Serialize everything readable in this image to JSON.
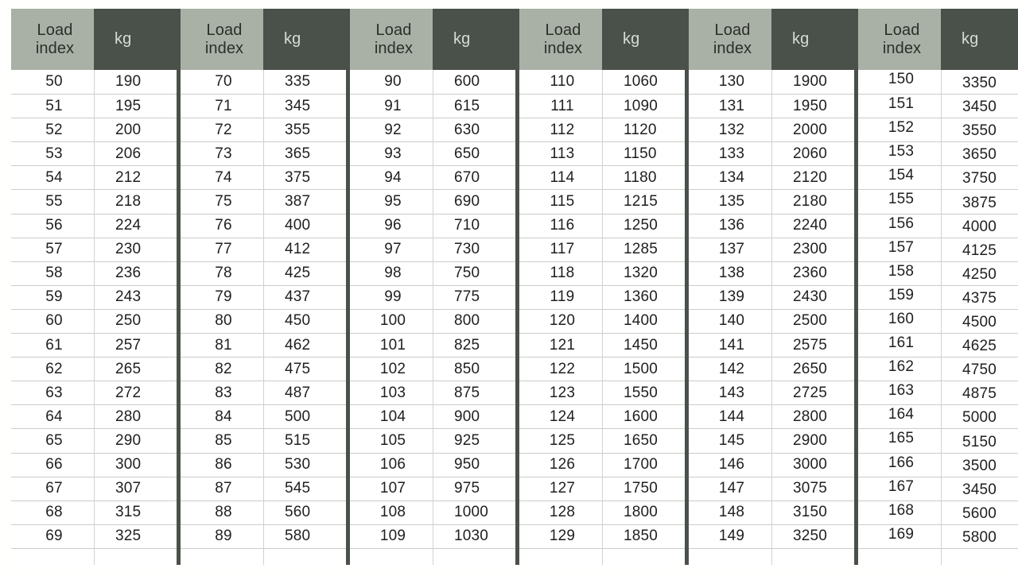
{
  "table": {
    "header": {
      "index_label": "Load\nindex",
      "kg_label": "kg"
    },
    "colors": {
      "header_index_bg": "#a9b0a6",
      "header_kg_bg": "#4a514a",
      "header_kg_text": "#d8dcd6",
      "group_separator": "#4a514a",
      "row_divider": "#c9cdc7",
      "body_bg": "#ffffff",
      "page_bg": "#fffffd",
      "body_text": "#1d201d"
    },
    "groups": [
      {
        "name": "group-50-69",
        "rows": [
          {
            "index": "50",
            "kg": "190"
          },
          {
            "index": "51",
            "kg": "195"
          },
          {
            "index": "52",
            "kg": "200"
          },
          {
            "index": "53",
            "kg": "206"
          },
          {
            "index": "54",
            "kg": "212"
          },
          {
            "index": "55",
            "kg": "218"
          },
          {
            "index": "56",
            "kg": "224"
          },
          {
            "index": "57",
            "kg": "230"
          },
          {
            "index": "58",
            "kg": "236"
          },
          {
            "index": "59",
            "kg": "243"
          },
          {
            "index": "60",
            "kg": "250"
          },
          {
            "index": "61",
            "kg": "257"
          },
          {
            "index": "62",
            "kg": "265"
          },
          {
            "index": "63",
            "kg": "272"
          },
          {
            "index": "64",
            "kg": "280"
          },
          {
            "index": "65",
            "kg": "290"
          },
          {
            "index": "66",
            "kg": "300"
          },
          {
            "index": "67",
            "kg": "307"
          },
          {
            "index": "68",
            "kg": "315"
          },
          {
            "index": "69",
            "kg": "325"
          }
        ]
      },
      {
        "name": "group-70-89",
        "rows": [
          {
            "index": "70",
            "kg": "335"
          },
          {
            "index": "71",
            "kg": "345"
          },
          {
            "index": "72",
            "kg": "355"
          },
          {
            "index": "73",
            "kg": "365"
          },
          {
            "index": "74",
            "kg": "375"
          },
          {
            "index": "75",
            "kg": "387"
          },
          {
            "index": "76",
            "kg": "400"
          },
          {
            "index": "77",
            "kg": "412"
          },
          {
            "index": "78",
            "kg": "425"
          },
          {
            "index": "79",
            "kg": "437"
          },
          {
            "index": "80",
            "kg": "450"
          },
          {
            "index": "81",
            "kg": "462"
          },
          {
            "index": "82",
            "kg": "475"
          },
          {
            "index": "83",
            "kg": "487"
          },
          {
            "index": "84",
            "kg": "500"
          },
          {
            "index": "85",
            "kg": "515"
          },
          {
            "index": "86",
            "kg": "530"
          },
          {
            "index": "87",
            "kg": "545"
          },
          {
            "index": "88",
            "kg": "560"
          },
          {
            "index": "89",
            "kg": "580"
          }
        ]
      },
      {
        "name": "group-90-109",
        "rows": [
          {
            "index": "90",
            "kg": "600"
          },
          {
            "index": "91",
            "kg": "615"
          },
          {
            "index": "92",
            "kg": "630"
          },
          {
            "index": "93",
            "kg": "650"
          },
          {
            "index": "94",
            "kg": "670"
          },
          {
            "index": "95",
            "kg": "690"
          },
          {
            "index": "96",
            "kg": "710"
          },
          {
            "index": "97",
            "kg": "730"
          },
          {
            "index": "98",
            "kg": "750"
          },
          {
            "index": "99",
            "kg": "775"
          },
          {
            "index": "100",
            "kg": "800"
          },
          {
            "index": "101",
            "kg": "825"
          },
          {
            "index": "102",
            "kg": "850"
          },
          {
            "index": "103",
            "kg": "875"
          },
          {
            "index": "104",
            "kg": "900"
          },
          {
            "index": "105",
            "kg": "925"
          },
          {
            "index": "106",
            "kg": "950"
          },
          {
            "index": "107",
            "kg": "975"
          },
          {
            "index": "108",
            "kg": "1000"
          },
          {
            "index": "109",
            "kg": "1030"
          }
        ]
      },
      {
        "name": "group-110-129",
        "rows": [
          {
            "index": "110",
            "kg": "1060"
          },
          {
            "index": "111",
            "kg": "1090"
          },
          {
            "index": "112",
            "kg": "1120"
          },
          {
            "index": "113",
            "kg": "1150"
          },
          {
            "index": "114",
            "kg": "1180"
          },
          {
            "index": "115",
            "kg": "1215"
          },
          {
            "index": "116",
            "kg": "1250"
          },
          {
            "index": "117",
            "kg": "1285"
          },
          {
            "index": "118",
            "kg": "1320"
          },
          {
            "index": "119",
            "kg": "1360"
          },
          {
            "index": "120",
            "kg": "1400"
          },
          {
            "index": "121",
            "kg": "1450"
          },
          {
            "index": "122",
            "kg": "1500"
          },
          {
            "index": "123",
            "kg": "1550"
          },
          {
            "index": "124",
            "kg": "1600"
          },
          {
            "index": "125",
            "kg": "1650"
          },
          {
            "index": "126",
            "kg": "1700"
          },
          {
            "index": "127",
            "kg": "1750"
          },
          {
            "index": "128",
            "kg": "1800"
          },
          {
            "index": "129",
            "kg": "1850"
          }
        ]
      },
      {
        "name": "group-130-149",
        "rows": [
          {
            "index": "130",
            "kg": "1900"
          },
          {
            "index": "131",
            "kg": "1950"
          },
          {
            "index": "132",
            "kg": "2000"
          },
          {
            "index": "133",
            "kg": "2060"
          },
          {
            "index": "134",
            "kg": "2120"
          },
          {
            "index": "135",
            "kg": "2180"
          },
          {
            "index": "136",
            "kg": "2240"
          },
          {
            "index": "137",
            "kg": "2300"
          },
          {
            "index": "138",
            "kg": "2360"
          },
          {
            "index": "139",
            "kg": "2430"
          },
          {
            "index": "140",
            "kg": "2500"
          },
          {
            "index": "141",
            "kg": "2575"
          },
          {
            "index": "142",
            "kg": "2650"
          },
          {
            "index": "143",
            "kg": "2725"
          },
          {
            "index": "144",
            "kg": "2800"
          },
          {
            "index": "145",
            "kg": "2900"
          },
          {
            "index": "146",
            "kg": "3000"
          },
          {
            "index": "147",
            "kg": "3075"
          },
          {
            "index": "148",
            "kg": "3150"
          },
          {
            "index": "149",
            "kg": "3250"
          }
        ]
      },
      {
        "name": "group-150-169",
        "offset": true,
        "rows": [
          {
            "index": "150",
            "kg": "3350"
          },
          {
            "index": "151",
            "kg": "3450"
          },
          {
            "index": "152",
            "kg": "3550"
          },
          {
            "index": "153",
            "kg": "3650"
          },
          {
            "index": "154",
            "kg": "3750"
          },
          {
            "index": "155",
            "kg": "3875"
          },
          {
            "index": "156",
            "kg": "4000"
          },
          {
            "index": "157",
            "kg": "4125"
          },
          {
            "index": "158",
            "kg": "4250"
          },
          {
            "index": "159",
            "kg": "4375"
          },
          {
            "index": "160",
            "kg": "4500"
          },
          {
            "index": "161",
            "kg": "4625"
          },
          {
            "index": "162",
            "kg": "4750"
          },
          {
            "index": "163",
            "kg": "4875"
          },
          {
            "index": "164",
            "kg": "5000"
          },
          {
            "index": "165",
            "kg": "5150"
          },
          {
            "index": "166",
            "kg": "3500"
          },
          {
            "index": "167",
            "kg": "3450"
          },
          {
            "index": "168",
            "kg": "5600"
          },
          {
            "index": "169",
            "kg": "5800"
          }
        ]
      }
    ]
  }
}
